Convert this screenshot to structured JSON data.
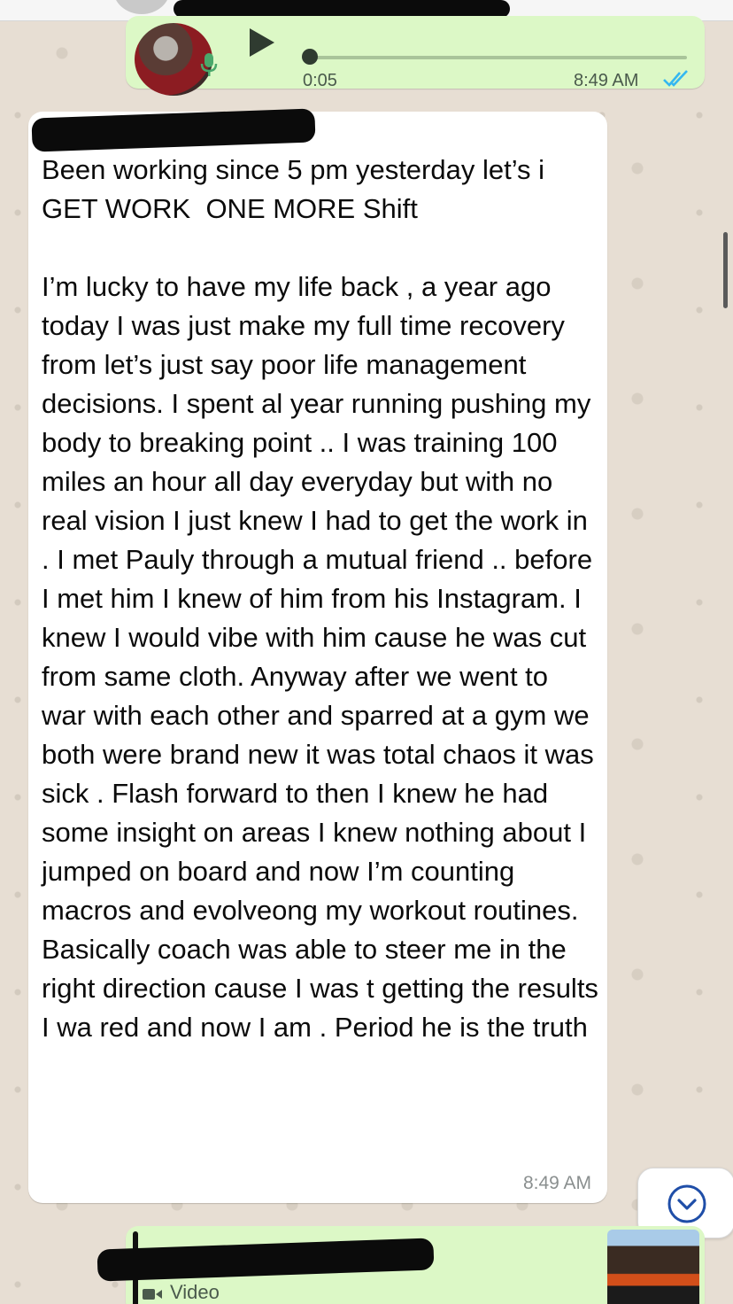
{
  "voice_message": {
    "duration": "0:05",
    "time": "8:49 AM",
    "status_icon": "double-check-read-icon"
  },
  "text_message": {
    "sender": "",
    "body": "Been working since 5 pm yesterday let’s i GET WORK  ONE MORE Shift\n\nI’m lucky to have my life back , a year ago today I was just make my full time recovery from let’s just say poor life management decisions. I spent al year running pushing my body to breaking point .. I was training 100 miles an hour all day everyday but with no real vision I just knew I had to get the work in . I met Pauly through a mutual friend .. before I met him I knew of him from his Instagram. I knew I would vibe with him cause he was cut from same cloth. Anyway after we went to war with each other and sparred at a gym we both were brand new it was total chaos it was sick . Flash forward to then I knew he had some insight on areas I knew nothing about I jumped on board and now I’m counting macros and evolveong my workout routines. Basically coach was able to steer me in the right direction cause I was t getting the results I wa red and now I am . Period he is the truth",
    "time": "8:49 AM"
  },
  "video_message": {
    "label": "Video",
    "icon": "video-camera-icon"
  },
  "controls": {
    "scroll_down_icon": "chevron-down-icon"
  },
  "colors": {
    "outgoing_bubble": "#dcf8c6",
    "incoming_bubble": "#ffffff",
    "read_ticks": "#34b7f1",
    "chat_background": "#e7ded3"
  }
}
